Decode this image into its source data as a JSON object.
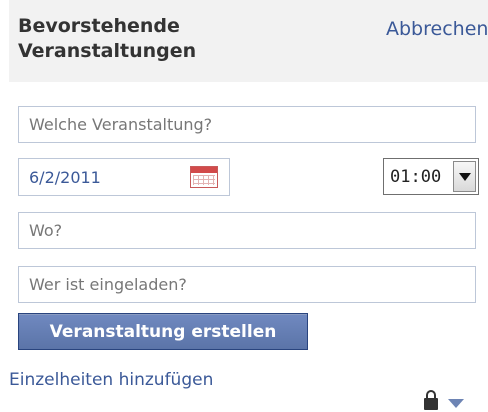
{
  "header": {
    "title": "Bevorstehende Veranstaltungen",
    "cancel_label": "Abbrechen"
  },
  "form": {
    "event_name_placeholder": "Welche Veranstaltung?",
    "date_value": "6/2/2011",
    "time_value": "01:00",
    "location_placeholder": "Wo?",
    "guests_placeholder": "Wer ist eingeladen?",
    "submit_label": "Veranstaltung erstellen",
    "details_link": "Einzelheiten hinzufügen"
  },
  "icons": {
    "calendar": "calendar-icon",
    "time_dropdown": "chevron-down-icon",
    "privacy_lock": "lock-icon",
    "privacy_dropdown": "chevron-down-icon"
  },
  "colors": {
    "link": "#3b5998",
    "button": "#5b74a8",
    "header_bg": "#f2f2f2",
    "input_border": "#bdc7d8",
    "calendar_red": "#d24a4a"
  }
}
